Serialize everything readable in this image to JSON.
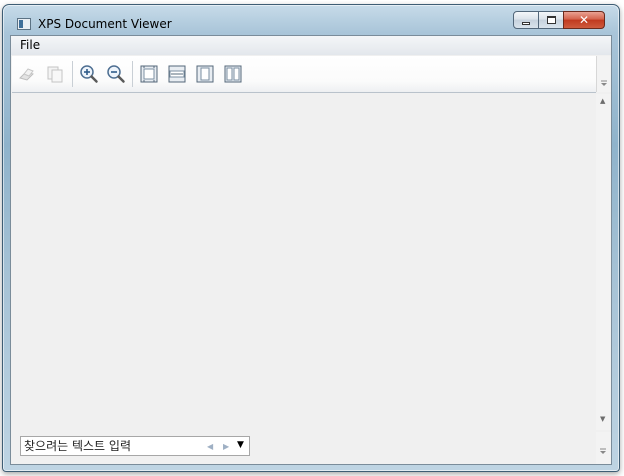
{
  "window": {
    "title": "XPS Document Viewer",
    "close_glyph": "✕"
  },
  "menubar": {
    "items": [
      {
        "label": "File"
      }
    ]
  },
  "toolbar": {
    "buttons": [
      {
        "icon": "print-icon",
        "enabled": false
      },
      {
        "icon": "copy-icon",
        "enabled": false
      },
      {
        "icon": "zoom-in-icon",
        "enabled": true
      },
      {
        "icon": "zoom-out-icon",
        "enabled": true
      },
      {
        "icon": "actual-size-icon",
        "enabled": true
      },
      {
        "icon": "page-width-icon",
        "enabled": true
      },
      {
        "icon": "whole-page-icon",
        "enabled": true
      },
      {
        "icon": "two-pages-icon",
        "enabled": true
      }
    ]
  },
  "find": {
    "placeholder": "찾으려는 텍스트 입력",
    "value": ""
  },
  "colors": {
    "accent": "#3f6f99",
    "close_button": "#c0391f",
    "viewer_background": "#f0f0f0"
  }
}
